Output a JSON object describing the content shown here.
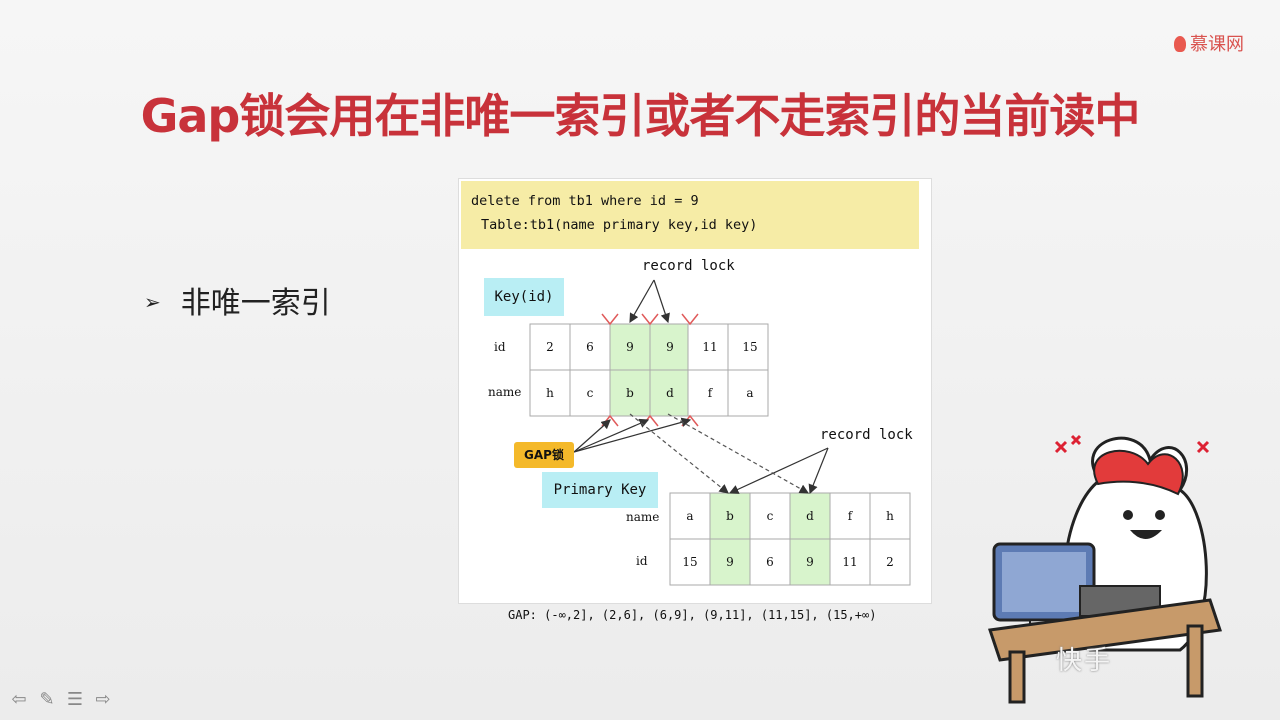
{
  "brand": {
    "name": "慕课网"
  },
  "title": "Gap锁会用在非唯一索引或者不走索引的当前读中",
  "bullet": {
    "marker": "➢",
    "text": "非唯一索引"
  },
  "figure": {
    "sql_line1": "delete from tb1 where id = 9",
    "sql_line2": "Table:tb1(name primary key,id key)",
    "record_lock_top": "record lock",
    "record_lock_right": "record lock",
    "key_label": "Key(id)",
    "pk_label": "Primary Key",
    "gap_lock_label": "GAP锁",
    "key_table": {
      "row_labels": [
        "id",
        "name"
      ],
      "id_values": [
        "2",
        "6",
        "9",
        "9",
        "11",
        "15"
      ],
      "name_values": [
        "h",
        "c",
        "b",
        "d",
        "f",
        "a"
      ],
      "highlight_cols": [
        2,
        3
      ]
    },
    "pk_table": {
      "row_labels": [
        "name",
        "id"
      ],
      "name_values": [
        "a",
        "b",
        "c",
        "d",
        "f",
        "h"
      ],
      "id_values": [
        "15",
        "9",
        "6",
        "9",
        "11",
        "2"
      ],
      "highlight_cols": [
        1,
        3
      ]
    },
    "gap_text": "GAP: (-∞,2], (2,6], (6,9], (9,11], (11,15], (15,+∞)"
  },
  "watermark": "快手",
  "colors": {
    "title": "#c8323a",
    "sql_bg": "#f6eca6",
    "label_bg": "#b9eef4",
    "highlight": "#d8f4cc",
    "gap_lock_bg": "#f4b92a",
    "marker": "#e05a5a"
  },
  "nav_icons": [
    "arrow-left-icon",
    "pen-icon",
    "menu-icon",
    "arrow-right-icon"
  ]
}
